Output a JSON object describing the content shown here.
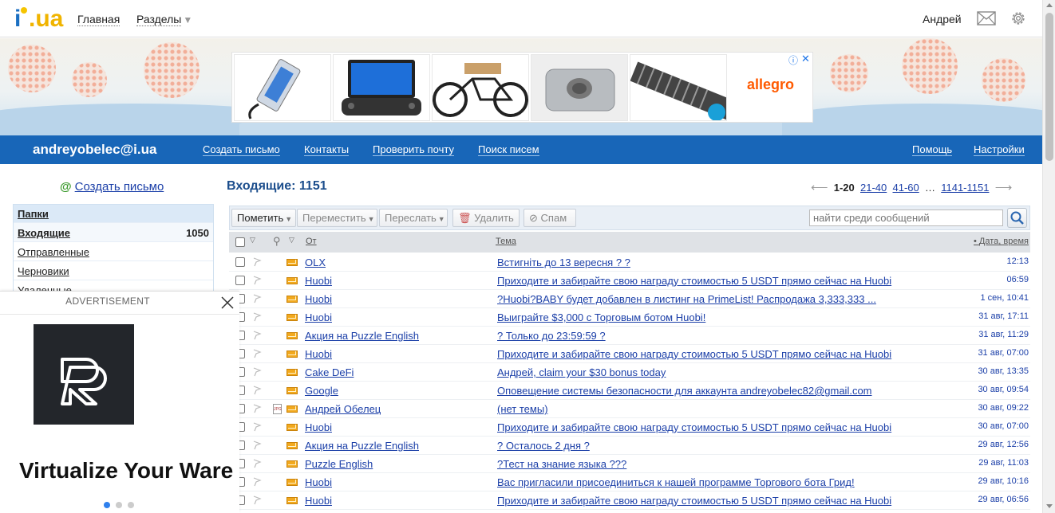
{
  "topbar": {
    "logo_text": "i.ua",
    "nav": [
      "Главная",
      "Разделы"
    ],
    "user_name": "Андрей",
    "icons": [
      "mail-icon",
      "gear-icon"
    ]
  },
  "banner_ad": {
    "brand": "allegro",
    "products": [
      "usb-ssd-enclosure",
      "handheld-mini-pc",
      "bicycle-wall-rack",
      "t-slot-nut",
      "threaded-rod"
    ]
  },
  "bluebar": {
    "email": "andreyobelec@i.ua",
    "links": [
      "Создать письмо",
      "Контакты",
      "Проверить почту",
      "Поиск писем"
    ],
    "help": "Помощь",
    "settings": "Настройки"
  },
  "sidebar": {
    "compose": "Создать письмо",
    "folders_title": "Папки",
    "folders": [
      {
        "name": "Входящие",
        "count": "1050"
      },
      {
        "name": "Отправленные",
        "count": ""
      },
      {
        "name": "Черновики",
        "count": ""
      },
      {
        "name": "Удаленные",
        "count": ""
      }
    ]
  },
  "advert": {
    "label": "ADVERTISEMENT",
    "headline": "Virtualize Your Ware"
  },
  "inbox": {
    "title": "Входящие: 1151",
    "pager": {
      "current": "1-20",
      "pages": [
        "21-40",
        "41-60"
      ],
      "ellipsis": "…",
      "last": "1141-1151"
    },
    "toolbar": {
      "mark": "Пометить",
      "move": "Переместить",
      "forward": "Переслать",
      "delete": "Удалить",
      "spam": "Спам",
      "search_placeholder": "найти среди сообщений"
    },
    "columns": {
      "from": "От",
      "subject": "Тема",
      "date": "Дата, время"
    },
    "messages": [
      {
        "from": "OLX",
        "subject": "Встигніть до 13 вересня ? ?",
        "date": "12:13",
        "attachment": false
      },
      {
        "from": "Huobi",
        "subject": "Приходите и забирайте свою награду стоимостью 5 USDT прямо сейчас на Huobi",
        "date": "06:59",
        "attachment": false
      },
      {
        "from": "Huobi",
        "subject": "?Huobi?BABY будет добавлен в листинг на PrimeList! Распродажа 3,333,333 ...",
        "date": "1 сен, 10:41",
        "attachment": false
      },
      {
        "from": "Huobi",
        "subject": "Выиграйте $3,000 с Торговым ботом Huobi!",
        "date": "31 авг, 17:11",
        "attachment": false
      },
      {
        "from": "Акция на Puzzle English",
        "subject": "? Только до 23:59:59 ?",
        "date": "31 авг, 11:29",
        "attachment": false
      },
      {
        "from": "Huobi",
        "subject": "Приходите и забирайте свою награду стоимостью 5 USDT прямо сейчас на Huobi",
        "date": "31 авг, 07:00",
        "attachment": false
      },
      {
        "from": "Cake DeFi",
        "subject": "Андрей, claim your $30 bonus today",
        "date": "30 авг, 13:35",
        "attachment": false
      },
      {
        "from": "Google",
        "subject": "Оповещение системы безопасности для аккаунта andreyobelec82@gmail.com",
        "date": "30 авг, 09:54",
        "attachment": false
      },
      {
        "from": "Андрей Обелец",
        "subject": "(нет темы)",
        "date": "30 авг, 09:22",
        "attachment": true
      },
      {
        "from": "Huobi",
        "subject": "Приходите и забирайте свою награду стоимостью 5 USDT прямо сейчас на Huobi",
        "date": "30 авг, 07:00",
        "attachment": false
      },
      {
        "from": "Акция на Puzzle English",
        "subject": "? Осталось 2 дня ?",
        "date": "29 авг, 12:56",
        "attachment": false
      },
      {
        "from": "Puzzle English",
        "subject": "?Тест на знание языка ???",
        "date": "29 авг, 11:03",
        "attachment": false
      },
      {
        "from": "Huobi",
        "subject": "Вас пригласили присоединиться к нашей программе Торгового бота Грид!",
        "date": "29 авг, 10:16",
        "attachment": false
      },
      {
        "from": "Huobi",
        "subject": "Приходите и забирайте свою награду стоимостью 5 USDT прямо сейчас на Huobi",
        "date": "29 авг, 06:56",
        "attachment": false
      }
    ]
  }
}
